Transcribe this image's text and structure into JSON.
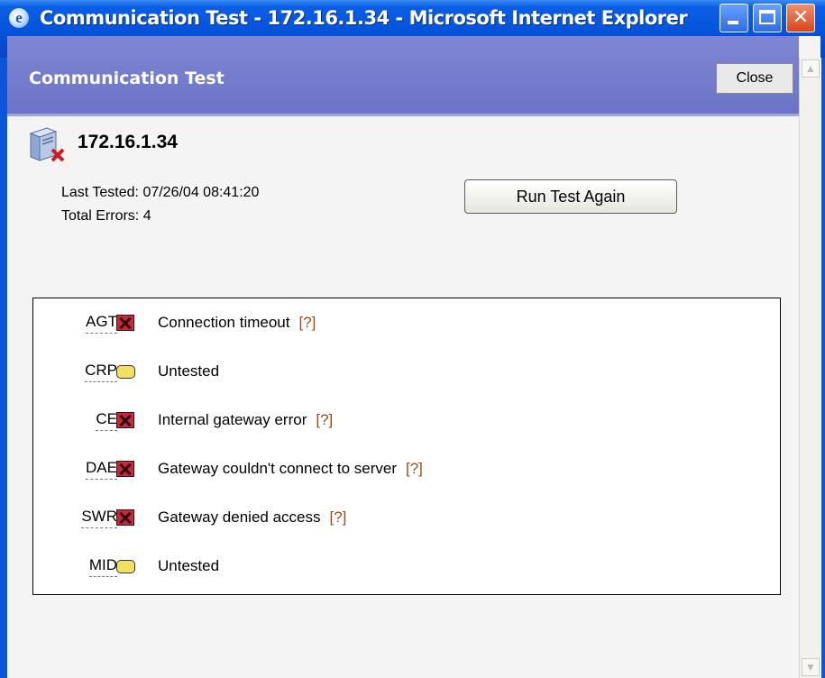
{
  "window": {
    "title": "Communication Test - 172.16.1.34 - Microsoft Internet Explorer"
  },
  "header": {
    "title": "Communication Test",
    "close_label": "Close"
  },
  "server": {
    "name": "172.16.1.34",
    "last_tested_label": "Last Tested:",
    "last_tested": "07/26/04 08:41:20",
    "total_errors_label": "Total Errors:",
    "total_errors": "4"
  },
  "actions": {
    "run_again_label": "Run Test Again"
  },
  "results": [
    {
      "code": "AGT",
      "status": "error",
      "message": "Connection timeout",
      "help": "[?]"
    },
    {
      "code": "CRP",
      "status": "untested",
      "message": "Untested",
      "help": ""
    },
    {
      "code": "CE",
      "status": "error",
      "message": "Internal gateway error",
      "help": "[?]"
    },
    {
      "code": "DAE",
      "status": "error",
      "message": "Gateway couldn't connect to server",
      "help": "[?]"
    },
    {
      "code": "SWR",
      "status": "error",
      "message": "Gateway denied access",
      "help": "[?]"
    },
    {
      "code": "MID",
      "status": "untested",
      "message": "Untested",
      "help": ""
    }
  ],
  "colors": {
    "header_bg": "#7079c9",
    "title_bar": "#0654dc",
    "error": "#c9273a",
    "untested": "#f3df62",
    "help_link": "#9e4a1c"
  }
}
